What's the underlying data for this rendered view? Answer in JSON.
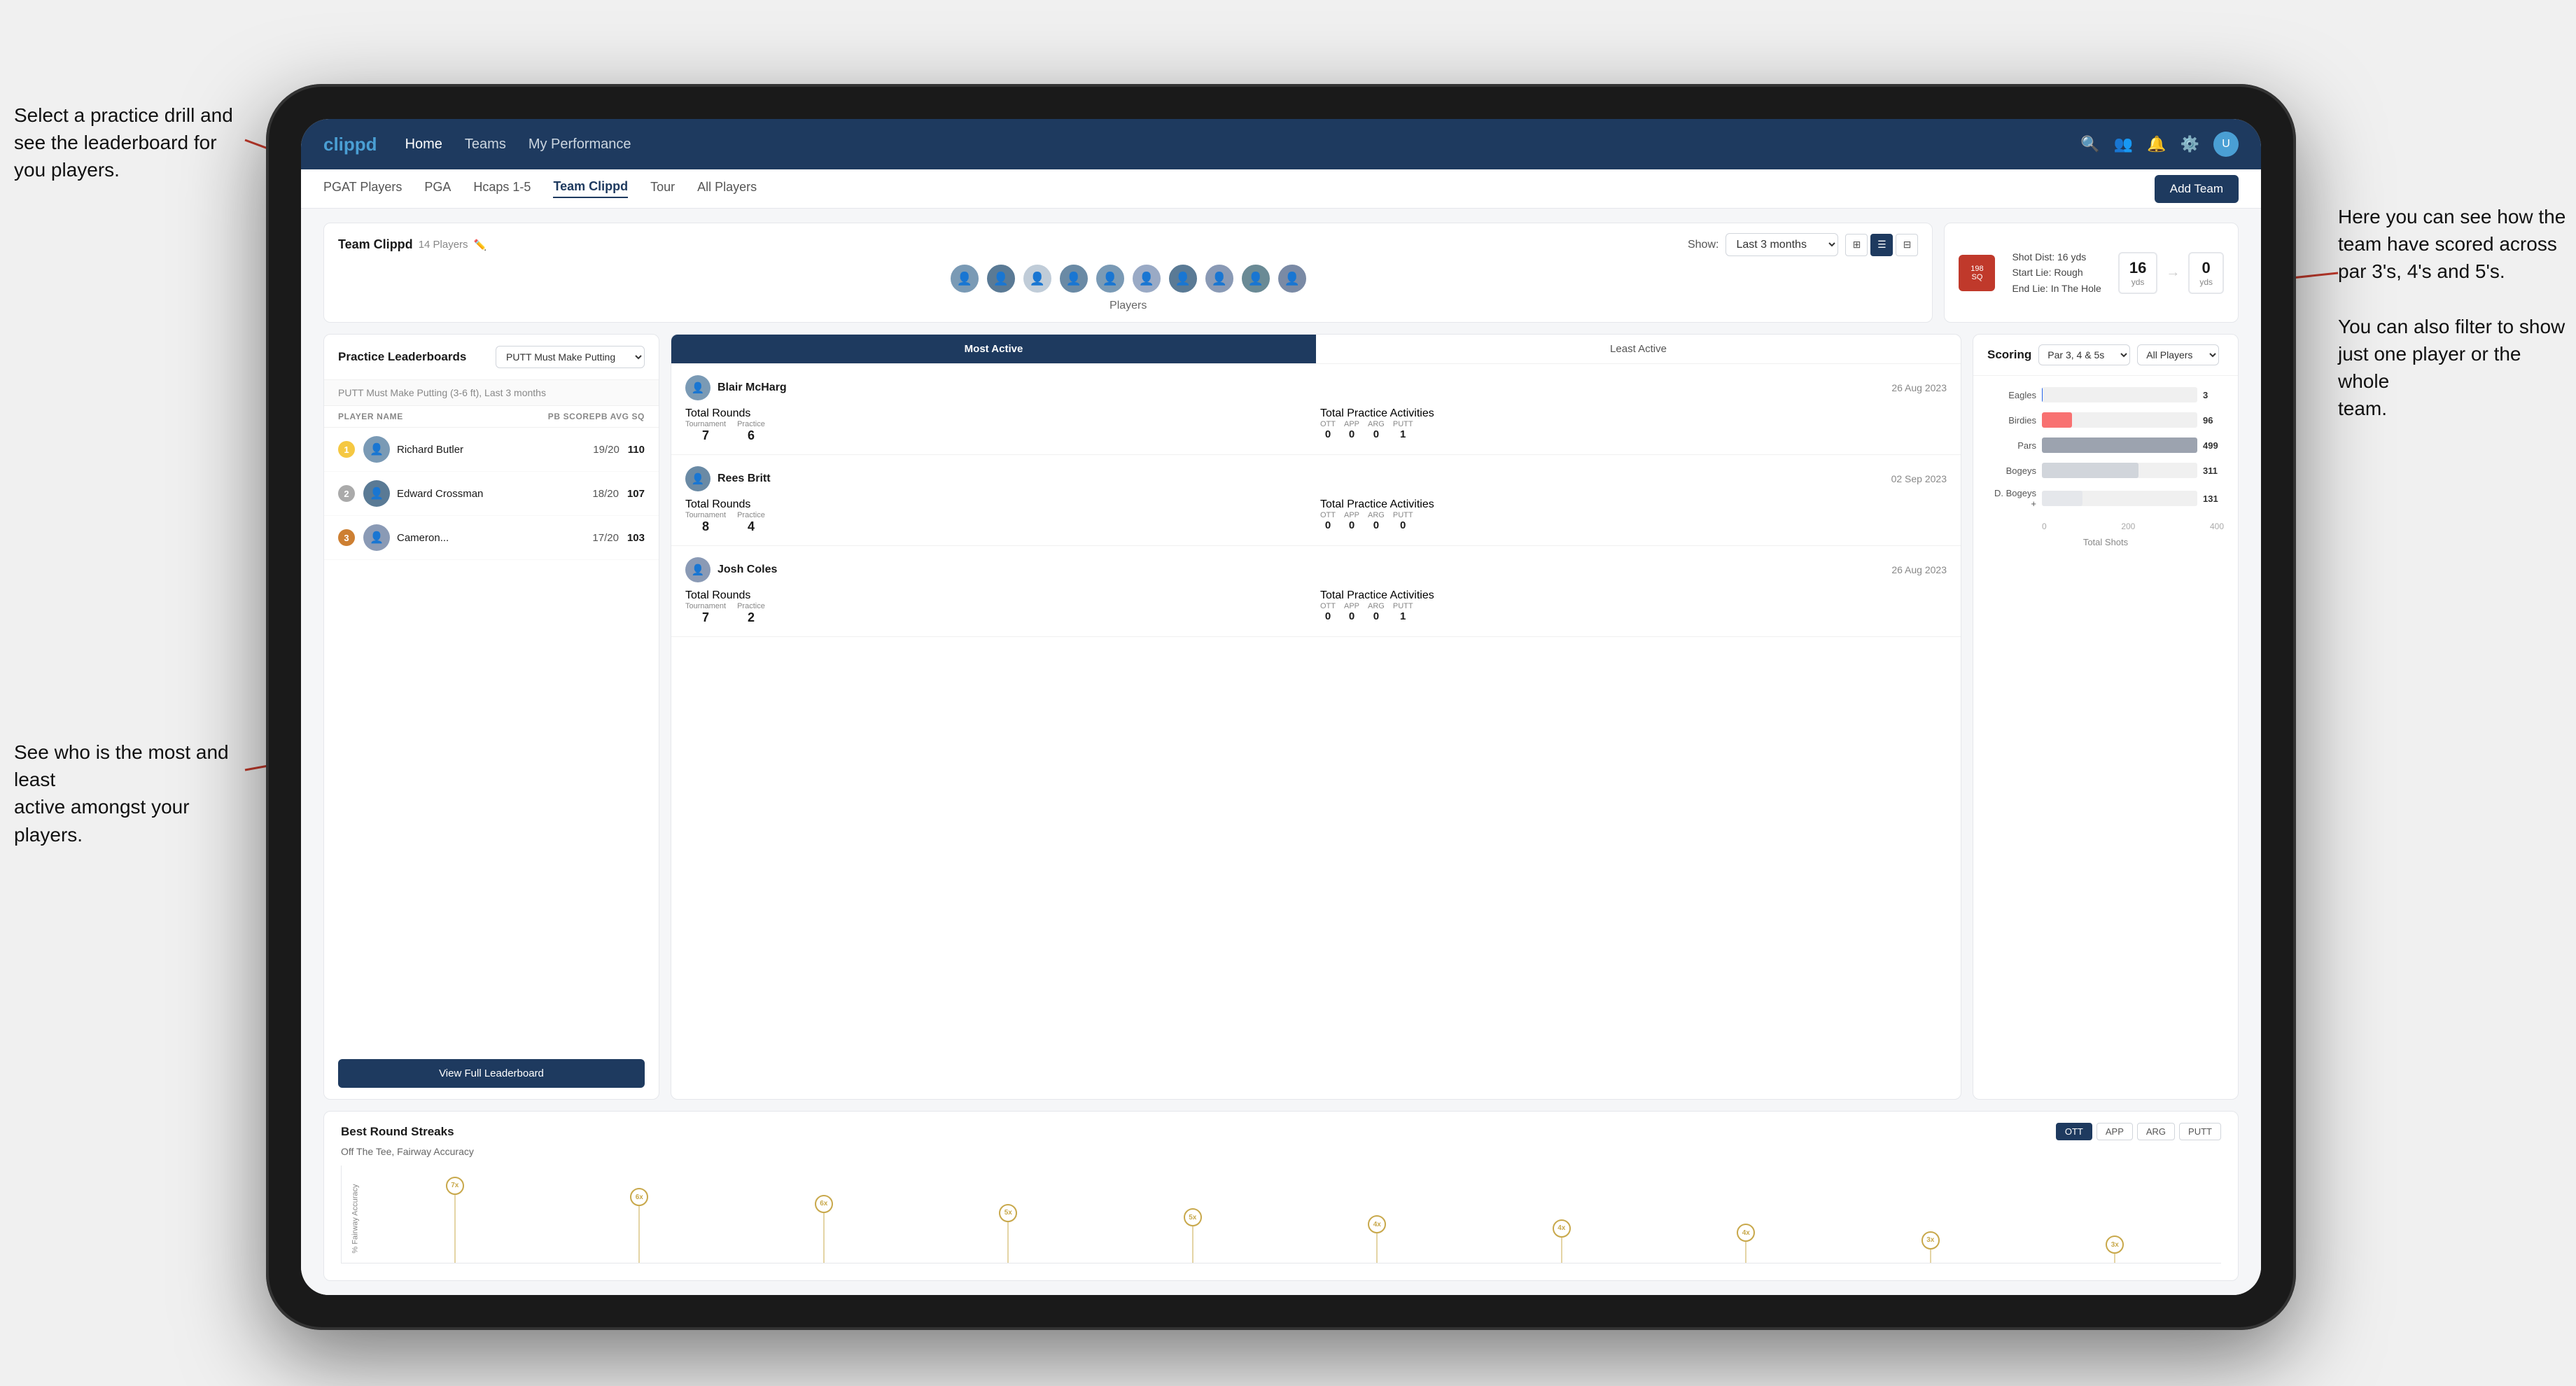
{
  "app": {
    "logo": "clippd",
    "nav_links": [
      "Home",
      "Teams",
      "My Performance"
    ],
    "sub_nav_links": [
      "PGAT Players",
      "PGA",
      "Hcaps 1-5",
      "Team Clippd",
      "Tour",
      "All Players"
    ],
    "active_sub_nav": "Team Clippd",
    "add_team_btn": "Add Team"
  },
  "team": {
    "name": "Team Clippd",
    "player_count": "14 Players",
    "show_label": "Show:",
    "period": "Last 3 months",
    "players_label": "Players"
  },
  "shot_info": {
    "badge_num": "198",
    "badge_sub": "SQ",
    "details_line1": "Shot Dist: 16 yds",
    "details_line2": "Start Lie: Rough",
    "details_line3": "End Lie: In The Hole",
    "yds_left": "16",
    "yds_left_label": "yds",
    "yds_right": "0",
    "yds_right_label": "yds"
  },
  "practice_leaderboard": {
    "title": "Practice Leaderboards",
    "drill": "PUTT Must Make Putting",
    "subtitle": "PUTT Must Make Putting (3-6 ft),",
    "subtitle_period": "Last 3 months",
    "col_player": "PLAYER NAME",
    "col_pb": "PB SCORE",
    "col_avg": "PB AVG SQ",
    "players": [
      {
        "rank": 1,
        "name": "Richard Butler",
        "score": "19/20",
        "avg": "110",
        "medal": "gold"
      },
      {
        "rank": 2,
        "name": "Edward Crossman",
        "score": "18/20",
        "avg": "107",
        "medal": "silver"
      },
      {
        "rank": 3,
        "name": "Cameron...",
        "score": "17/20",
        "avg": "103",
        "medal": "bronze"
      }
    ],
    "view_full_btn": "View Full Leaderboard"
  },
  "activity": {
    "tabs": [
      "Most Active",
      "Least Active"
    ],
    "active_tab": "Most Active",
    "entries": [
      {
        "name": "Blair McHarg",
        "date": "26 Aug 2023",
        "total_rounds_label": "Total Rounds",
        "tournament_label": "Tournament",
        "practice_label": "Practice",
        "tournament_val": "7",
        "practice_val": "6",
        "total_practice_label": "Total Practice Activities",
        "ott_label": "OTT",
        "app_label": "APP",
        "arg_label": "ARG",
        "putt_label": "PUTT",
        "ott_val": "0",
        "app_val": "0",
        "arg_val": "0",
        "putt_val": "1"
      },
      {
        "name": "Rees Britt",
        "date": "02 Sep 2023",
        "tournament_val": "8",
        "practice_val": "4",
        "ott_val": "0",
        "app_val": "0",
        "arg_val": "0",
        "putt_val": "0"
      },
      {
        "name": "Josh Coles",
        "date": "26 Aug 2023",
        "tournament_val": "7",
        "practice_val": "2",
        "ott_val": "0",
        "app_val": "0",
        "arg_val": "0",
        "putt_val": "1"
      }
    ]
  },
  "scoring": {
    "title": "Scoring",
    "filter1": "Par 3, 4 & 5s",
    "filter2": "All Players",
    "bars": [
      {
        "label": "Eagles",
        "val": 3,
        "max": 500,
        "color": "#2563eb"
      },
      {
        "label": "Birdies",
        "val": 96,
        "max": 500,
        "color": "#f87171"
      },
      {
        "label": "Pars",
        "val": 499,
        "max": 500,
        "color": "#9ca3af"
      },
      {
        "label": "Bogeys",
        "val": 311,
        "max": 500,
        "color": "#d1d5db"
      },
      {
        "label": "D. Bogeys +",
        "val": 131,
        "max": 500,
        "color": "#e5e7eb"
      }
    ],
    "x_labels": [
      "0",
      "200",
      "400"
    ],
    "x_axis_label": "Total Shots"
  },
  "streaks": {
    "title": "Best Round Streaks",
    "subtitle": "Off The Tee, Fairway Accuracy",
    "filters": [
      "OTT",
      "APP",
      "ARG",
      "PUTT"
    ],
    "active_filter": "OTT",
    "y_axis_label": "% Fairway Accuracy",
    "dots": [
      {
        "label": "7x",
        "height": 85
      },
      {
        "label": "6x",
        "height": 72
      },
      {
        "label": "6x",
        "height": 65
      },
      {
        "label": "5x",
        "height": 55
      },
      {
        "label": "5x",
        "height": 50
      },
      {
        "label": "4x",
        "height": 42
      },
      {
        "label": "4x",
        "height": 38
      },
      {
        "label": "4x",
        "height": 33
      },
      {
        "label": "3x",
        "height": 25
      },
      {
        "label": "3x",
        "height": 20
      }
    ]
  },
  "annotations": {
    "top_left": "Select a practice drill and see\nthe leaderboard for you players.",
    "bottom_left": "See who is the most and least\nactive amongst your players.",
    "top_right": "Here you can see how the\nteam have scored across\npar 3's, 4's and 5's.\n\nYou can also filter to show\njust one player or the whole\nteam.",
    "all_players": "All Players"
  }
}
